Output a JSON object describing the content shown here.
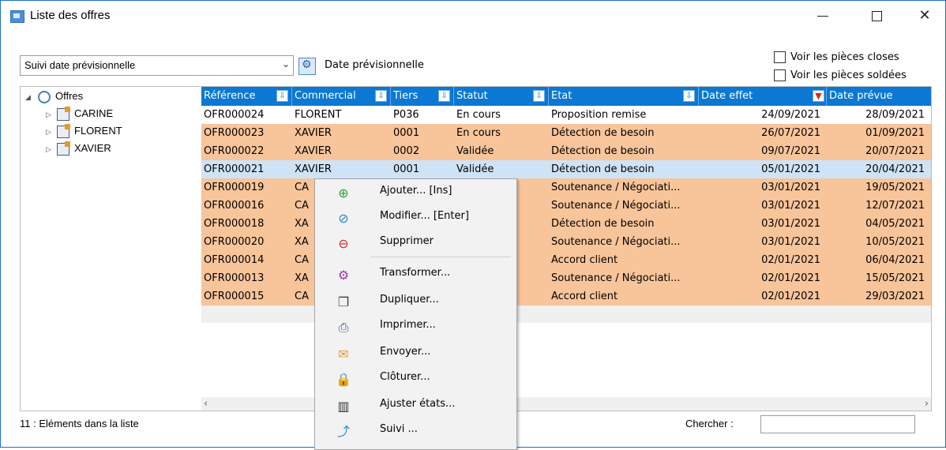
{
  "window": {
    "title": "Liste des offres"
  },
  "toolbar": {
    "view_select": "Suivi date prévisionnelle",
    "date_label": "Date prévisionnelle",
    "checkbox_closed": "Voir les pièces closes",
    "checkbox_settled": "Voir les pièces soldées"
  },
  "tree": {
    "root": "Offres",
    "nodes": [
      "CARINE",
      "FLORENT",
      "XAVIER"
    ]
  },
  "grid": {
    "columns": [
      "Référence",
      "Commercial",
      "Tiers",
      "Statut",
      "Etat",
      "Date effet",
      "Date prévue"
    ],
    "rows": [
      {
        "ref": "OFR000024",
        "commercial": "FLORENT",
        "tiers": "P036",
        "statut": "En cours",
        "etat": "Proposition remise",
        "date_effet": "24/09/2021",
        "date_prevue": "28/09/2021"
      },
      {
        "ref": "OFR000023",
        "commercial": "XAVIER",
        "tiers": "0001",
        "statut": "En cours",
        "etat": "Détection de besoin",
        "date_effet": "26/07/2021",
        "date_prevue": "01/09/2021"
      },
      {
        "ref": "OFR000022",
        "commercial": "XAVIER",
        "tiers": "0002",
        "statut": "Validée",
        "etat": "Détection de besoin",
        "date_effet": "09/07/2021",
        "date_prevue": "20/07/2021"
      },
      {
        "ref": "OFR000021",
        "commercial": "XAVIER",
        "tiers": "0001",
        "statut": "Validée",
        "etat": "Détection de besoin",
        "date_effet": "05/01/2021",
        "date_prevue": "20/04/2021"
      },
      {
        "ref": "OFR000019",
        "commercial": "CA",
        "tiers": "",
        "statut": "",
        "etat": "Soutenance / Négociati...",
        "date_effet": "03/01/2021",
        "date_prevue": "19/05/2021"
      },
      {
        "ref": "OFR000016",
        "commercial": "CA",
        "tiers": "",
        "statut": "",
        "etat": "Soutenance / Négociati...",
        "date_effet": "03/01/2021",
        "date_prevue": "12/07/2021"
      },
      {
        "ref": "OFR000018",
        "commercial": "XA",
        "tiers": "",
        "statut": "",
        "etat": "Détection de besoin",
        "date_effet": "03/01/2021",
        "date_prevue": "04/05/2021"
      },
      {
        "ref": "OFR000020",
        "commercial": "XA",
        "tiers": "",
        "statut": "",
        "etat": "Soutenance / Négociati...",
        "date_effet": "03/01/2021",
        "date_prevue": "10/05/2021"
      },
      {
        "ref": "OFR000014",
        "commercial": "CA",
        "tiers": "",
        "statut": "",
        "etat": "Accord client",
        "date_effet": "02/01/2021",
        "date_prevue": "06/04/2021"
      },
      {
        "ref": "OFR000013",
        "commercial": "XA",
        "tiers": "",
        "statut": "",
        "etat": "Soutenance / Négociati...",
        "date_effet": "02/01/2021",
        "date_prevue": "15/05/2021"
      },
      {
        "ref": "OFR000015",
        "commercial": "CA",
        "tiers": "",
        "statut": "",
        "etat": "Accord client",
        "date_effet": "02/01/2021",
        "date_prevue": "29/03/2021"
      }
    ]
  },
  "status": {
    "count_text": "11 : Eléments dans la liste",
    "search_label": "Chercher :",
    "search_value": ""
  },
  "context_menu": {
    "items": [
      {
        "label": "Ajouter... [Ins]",
        "icon": "plus-circle-icon"
      },
      {
        "label": "Modifier... [Enter]",
        "icon": "edit-circle-icon"
      },
      {
        "label": "Supprimer",
        "icon": "minus-circle-icon"
      },
      {
        "label": "Transformer...",
        "icon": "transform-icon"
      },
      {
        "label": "Dupliquer...",
        "icon": "duplicate-icon"
      },
      {
        "label": "Imprimer...",
        "icon": "printer-icon"
      },
      {
        "label": "Envoyer...",
        "icon": "envelope-icon"
      },
      {
        "label": "Clôturer...",
        "icon": "lock-icon"
      },
      {
        "label": "Ajuster états...",
        "icon": "traffic-light-icon"
      },
      {
        "label": "Suivi ...",
        "icon": "tracking-icon"
      }
    ]
  },
  "colors": {
    "header_blue": "#0b78d4",
    "row_orange": "#f8c49a",
    "row_selected": "#cfe3f7"
  }
}
